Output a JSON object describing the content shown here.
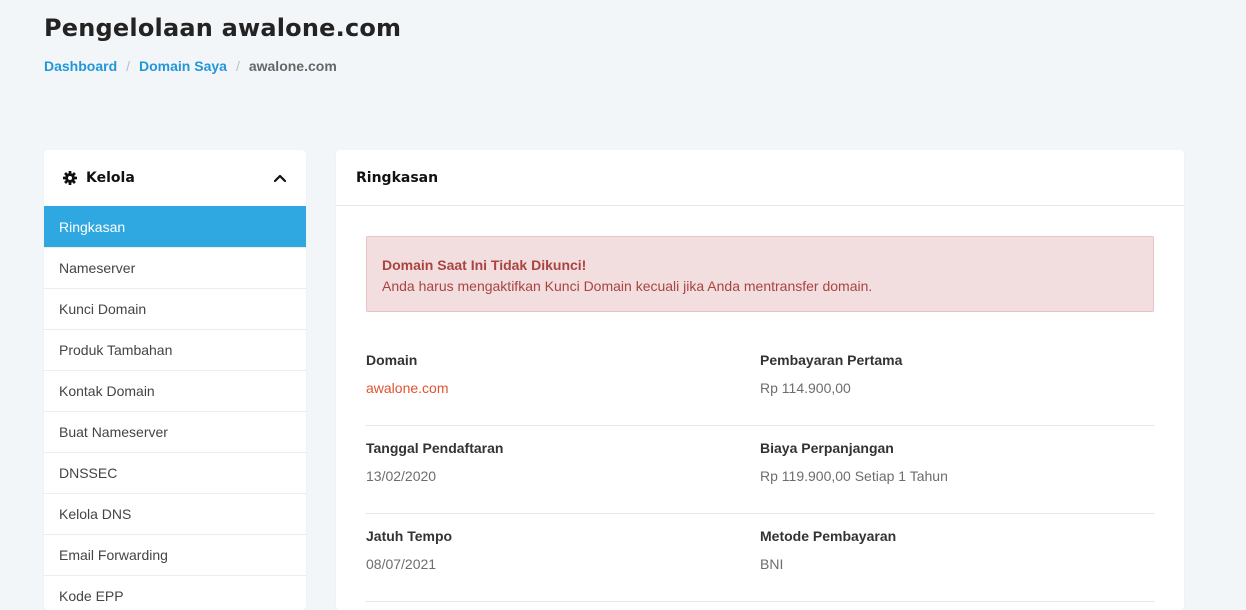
{
  "page": {
    "title": "Pengelolaan awalone.com"
  },
  "breadcrumb": {
    "items": [
      "Dashboard",
      "Domain Saya"
    ],
    "separator": "/",
    "current": "awalone.com"
  },
  "sidebar": {
    "title": "Kelola",
    "icon": "gear-icon",
    "collapse_icon": "chevron-up-icon",
    "items": [
      {
        "label": "Ringkasan",
        "active": true
      },
      {
        "label": "Nameserver"
      },
      {
        "label": "Kunci Domain"
      },
      {
        "label": "Produk Tambahan"
      },
      {
        "label": "Kontak Domain"
      },
      {
        "label": "Buat Nameserver"
      },
      {
        "label": "DNSSEC"
      },
      {
        "label": "Kelola DNS"
      },
      {
        "label": "Email Forwarding"
      },
      {
        "label": "Kode EPP"
      }
    ]
  },
  "panel": {
    "title": "Ringkasan",
    "alert": {
      "title": "Domain Saat Ini Tidak Dikunci!",
      "message": "Anda harus mengaktifkan Kunci Domain kecuali jika Anda mentransfer domain."
    },
    "info": [
      {
        "left": {
          "label": "Domain",
          "value": "awalone.com"
        },
        "right": {
          "label": "Pembayaran Pertama",
          "value": "Rp 114.900,00"
        }
      },
      {
        "left": {
          "label": "Tanggal Pendaftaran",
          "value": "13/02/2020"
        },
        "right": {
          "label": "Biaya Perpanjangan",
          "value": "Rp 119.900,00 Setiap 1 Tahun"
        }
      },
      {
        "left": {
          "label": "Jatuh Tempo",
          "value": "08/07/2021"
        },
        "right": {
          "label": "Metode Pembayaran",
          "value": "BNI"
        }
      }
    ]
  },
  "colors": {
    "accent": "#2fa8e2",
    "link": "#2196d9",
    "domain_link": "#e0532e",
    "alert_bg": "#f2dede",
    "alert_text": "#a94442",
    "page_bg": "#f3f6f9"
  }
}
